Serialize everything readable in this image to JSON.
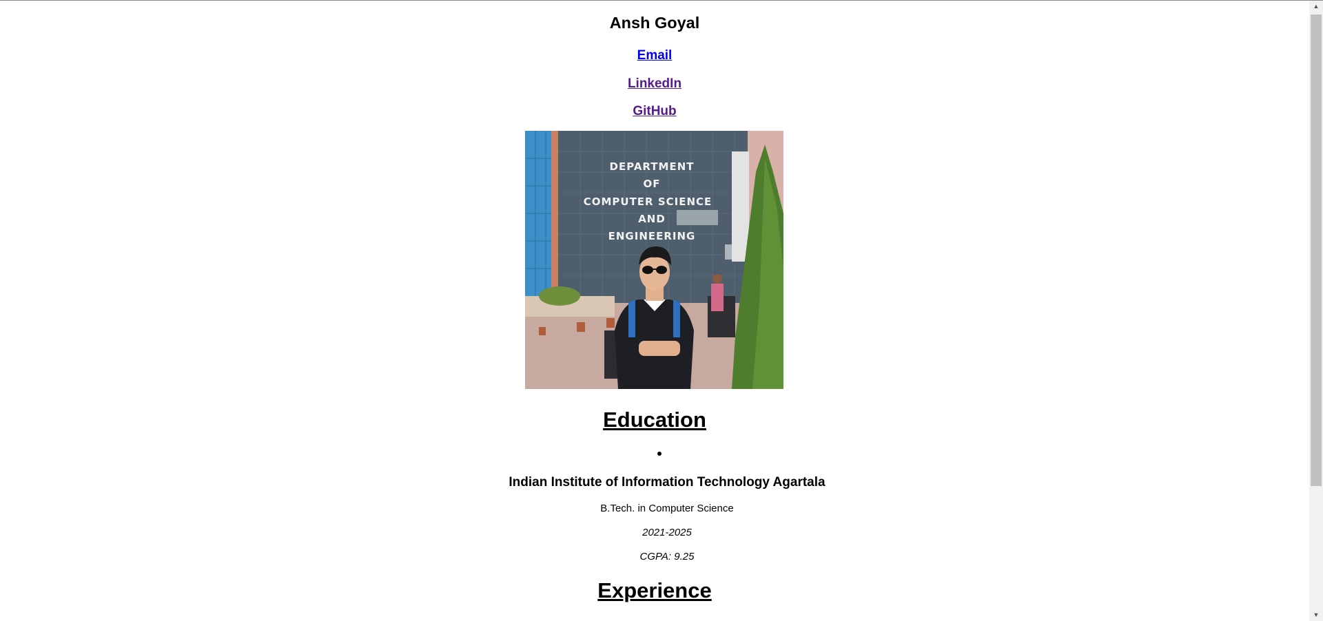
{
  "profile": {
    "name": "Ansh Goyal",
    "links": {
      "email": "Email",
      "linkedin": "LinkedIn",
      "github": "GitHub"
    },
    "photo": {
      "sign_lines": [
        "DEPARTMENT",
        "OF",
        "COMPUTER SCIENCE",
        "AND",
        "ENGINEERING"
      ]
    }
  },
  "education": {
    "heading": "Education",
    "items": [
      {
        "institute": "Indian Institute of Information Technology Agartala",
        "degree": "B.Tech. in Computer Science",
        "years": "2021-2025",
        "cgpa": "CGPA: 9.25"
      }
    ]
  },
  "experience": {
    "heading": "Experience"
  },
  "colors": {
    "link_unvisited": "#0000ee",
    "link_visited": "#551a8b",
    "scrollbar_track": "#f1f1f1",
    "scrollbar_thumb": "#c1c1c1"
  },
  "icons": {
    "scroll_up": "scroll-up-arrow-icon",
    "scroll_down": "scroll-down-arrow-icon"
  }
}
